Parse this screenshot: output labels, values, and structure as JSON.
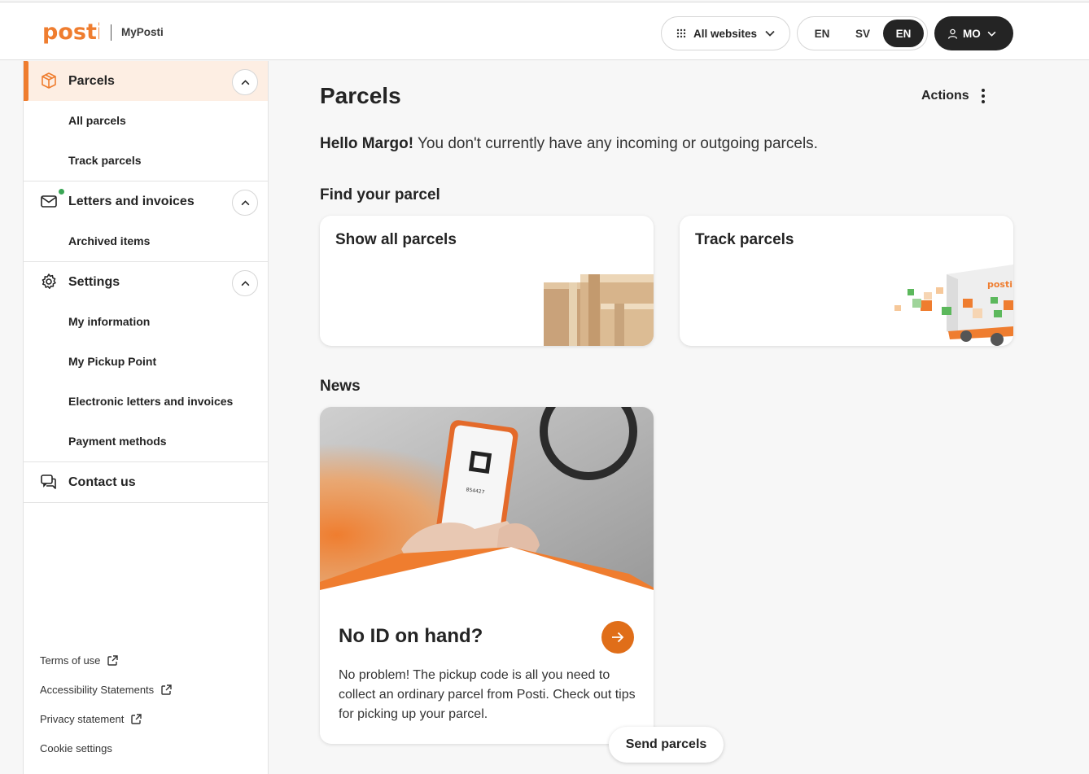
{
  "header": {
    "logo_text": "posti",
    "app_name": "MyPosti",
    "websites_label": "All websites",
    "languages": [
      "EN",
      "SV",
      "EN"
    ],
    "active_language_index": 2,
    "user_initials": "MO"
  },
  "sidebar": {
    "sections": [
      {
        "label": "Parcels",
        "icon": "box-icon",
        "items": [
          "All parcels",
          "Track parcels"
        ]
      },
      {
        "label": "Letters and invoices",
        "icon": "mail-icon",
        "items": [
          "Archived items"
        ]
      },
      {
        "label": "Settings",
        "icon": "gear-icon",
        "items": [
          "My information",
          "My Pickup Point",
          "Electronic letters and invoices",
          "Payment methods"
        ]
      },
      {
        "label": "Contact us",
        "icon": "chat-icon",
        "items": []
      }
    ],
    "footer_links": [
      "Terms of use",
      "Accessibility Statements",
      "Privacy statement",
      "Cookie settings"
    ]
  },
  "main": {
    "title": "Parcels",
    "actions_label": "Actions",
    "greeting_name": "Hello Margo!",
    "greeting_text": " You don't currently have any incoming or outgoing parcels.",
    "find_title": "Find your parcel",
    "cards": [
      "Show all parcels",
      "Track parcels"
    ],
    "news_title": "News",
    "news_card": {
      "title": "No ID on hand?",
      "text": "No problem! The pickup code is all you need to collect an ordinary parcel from Posti. Check out tips for picking up your parcel.",
      "phone_code": "854427",
      "truck_logo": "posti"
    },
    "send_button": "Send parcels"
  },
  "colors": {
    "brand_orange": "#ef7d2f",
    "dark": "#242424",
    "active_bg": "#fdeee3",
    "notification_green": "#3aa655"
  }
}
